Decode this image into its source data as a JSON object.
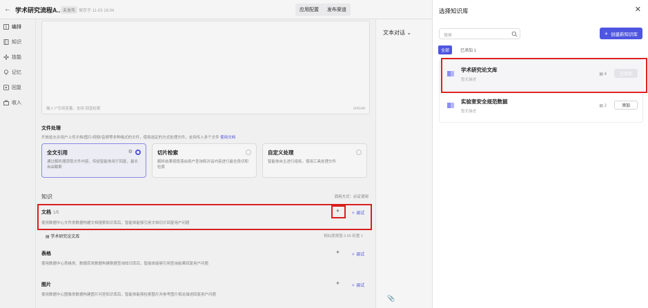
{
  "header": {
    "back_icon": "arrow-left-icon",
    "title": "学术研究流程A...",
    "status_badge": "未发布",
    "saved_text": "保存于 11-03 16:04",
    "tabs": [
      "应用配置",
      "发布渠道"
    ]
  },
  "sidebar": {
    "items": [
      {
        "label": "编排",
        "icon": "grid-icon"
      },
      {
        "label": "知识",
        "icon": "book-icon"
      },
      {
        "label": "技能",
        "icon": "sparkle-icon"
      },
      {
        "label": "记忆",
        "icon": "pin-icon"
      },
      {
        "label": "回复",
        "icon": "reply-icon"
      },
      {
        "label": "收入",
        "icon": "bag-icon"
      }
    ]
  },
  "prompt": {
    "placeholder": "输入\"/\"引用变量，支持 回显检索",
    "count": "0/4144"
  },
  "file_processing": {
    "title": "文件处理",
    "desc": "开放给允许用户上传文档/图片/视频/音频等多种格式的文件，使用选定的方式处理文件，支持传入多个文件",
    "link": "使用文档",
    "cards": [
      {
        "title": "全文引用",
        "desc": "通过解析器获取文件内容，传给智能体用于回复，最长自由截断",
        "selected": true
      },
      {
        "title": "切片检索",
        "desc": "解析结果按段落由用户查询和对话内容进行最全段切和检索",
        "selected": false
      },
      {
        "title": "自定义处理",
        "desc": "智能体自主进行组拆，使用工具处理文件",
        "selected": false
      }
    ]
  },
  "knowledge": {
    "title": "知识",
    "call_mode": "调用方式：必定调用",
    "rows": [
      {
        "name": "文档",
        "count": "1/5",
        "desc": "使用数据中心文件类数据构建文档搜索知识库后，智能体能够引用文档切片回复用户问题",
        "add": "+",
        "debug": "调试"
      },
      {
        "name": "表格",
        "count": "",
        "desc": "使用数据中心表格类、数据库类数据构建数据查询知识库后，智能体能够引用查询结果回复用户问题",
        "add": "+",
        "debug": "调试"
      },
      {
        "name": "图片",
        "count": "",
        "desc": "使用数据中心图像类数据构建图片问答知识库后，智能体能够检索图片并参考图片相关描述回复用户问题",
        "add": "+",
        "debug": "调试"
      }
    ],
    "attached": {
      "name": "学术研究论文库",
      "meta": "相似度阈值 0.65    权重 1"
    }
  },
  "preview": {
    "title": "文本对话"
  },
  "modal": {
    "title": "选择知识库",
    "search_placeholder": "搜索",
    "create_label": "创建新知识库",
    "filter_all": "全部",
    "filter_added": "已添加 1",
    "items": [
      {
        "name": "学术研究论文库",
        "desc": "暂无描述",
        "count": "4",
        "button": "已添加"
      },
      {
        "name": "实验室安全规范数据",
        "desc": "暂无描述",
        "count": "2",
        "button": "添加"
      }
    ]
  },
  "colors": {
    "accent": "#4e55e0",
    "highlight": "#e02020"
  }
}
